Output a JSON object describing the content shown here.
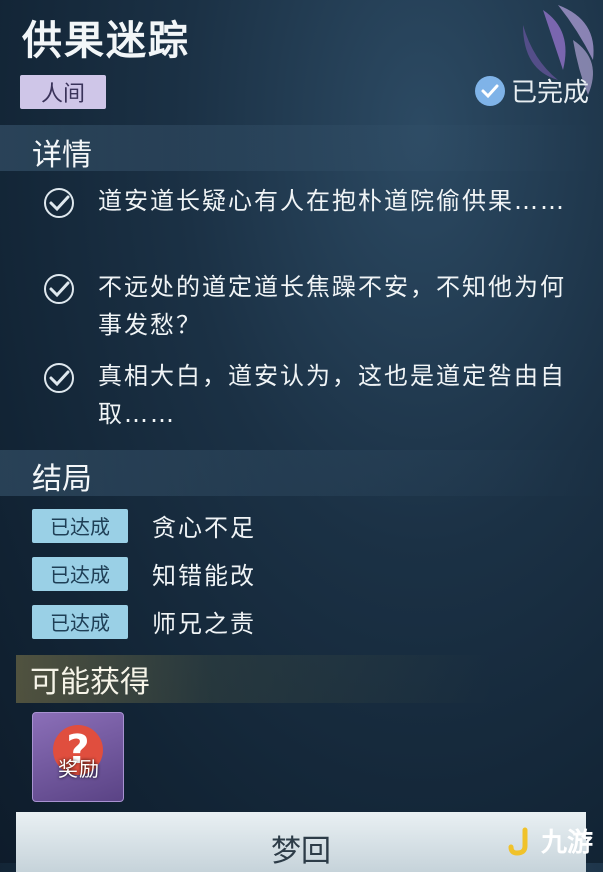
{
  "quest": {
    "title": "供果迷踪",
    "region": "人间",
    "status": "已完成"
  },
  "details": {
    "title": "详情",
    "items": [
      {
        "text": "道安道长疑心有人在抱朴道院偷供果……"
      },
      {
        "text": "不远处的道定道长焦躁不安，不知他为何事发愁？"
      },
      {
        "text": "真相大白，道安认为，这也是道定咎由自取……"
      }
    ]
  },
  "endings": {
    "title": "结局",
    "items": [
      {
        "badge": "已达成",
        "name": "贪心不足"
      },
      {
        "badge": "已达成",
        "name": "知错能改"
      },
      {
        "badge": "已达成",
        "name": "师兄之责"
      }
    ]
  },
  "rewards": {
    "title": "可能获得",
    "item_label": "奖励",
    "item_icon": "question-mark-icon"
  },
  "button": {
    "label": "梦回"
  },
  "watermark": {
    "text": "九游"
  },
  "colors": {
    "region_tag_bg": "#cfc6e8",
    "status_check": "#7fb3e8",
    "ending_badge_bg": "#9ad0e6",
    "reward_bg": "#8b6fb8",
    "watermark_accent": "#f0c22a"
  }
}
